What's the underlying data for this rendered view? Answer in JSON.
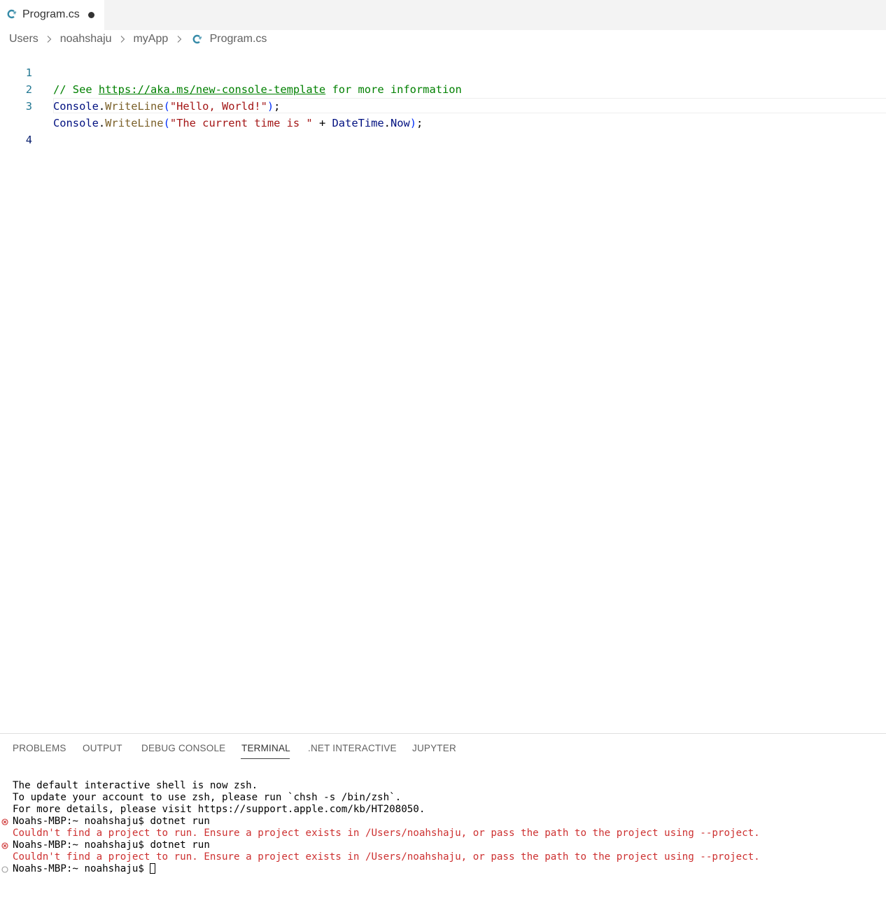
{
  "tab": {
    "label": "Program.cs",
    "dirty_indicator": "●"
  },
  "breadcrumb": {
    "items": [
      "Users",
      "noahshaju",
      "myApp",
      "Program.cs"
    ]
  },
  "editor": {
    "line_numbers": [
      "1",
      "2",
      "3",
      "4"
    ],
    "lines": [
      [
        {
          "text": "// See ",
          "kind": "comment"
        },
        {
          "text": "https://aka.ms/new-console-template",
          "kind": "link"
        },
        {
          "text": " for more information",
          "kind": "comment"
        }
      ],
      [
        {
          "text": "Console",
          "kind": "type"
        },
        {
          "text": ".",
          "kind": "punc"
        },
        {
          "text": "WriteLine",
          "kind": "method"
        },
        {
          "text": "(",
          "kind": "paren"
        },
        {
          "text": "\"Hello, World!\"",
          "kind": "string"
        },
        {
          "text": ")",
          "kind": "paren"
        },
        {
          "text": ";",
          "kind": "punc"
        }
      ],
      [
        {
          "text": "Console",
          "kind": "type"
        },
        {
          "text": ".",
          "kind": "punc"
        },
        {
          "text": "WriteLine",
          "kind": "method"
        },
        {
          "text": "(",
          "kind": "paren"
        },
        {
          "text": "\"The current time is \"",
          "kind": "string"
        },
        {
          "text": " + ",
          "kind": "punc"
        },
        {
          "text": "DateTime",
          "kind": "type"
        },
        {
          "text": ".",
          "kind": "punc"
        },
        {
          "text": "Now",
          "kind": "type"
        },
        {
          "text": ")",
          "kind": "paren"
        },
        {
          "text": ";",
          "kind": "punc"
        }
      ],
      []
    ]
  },
  "panel": {
    "tabs": [
      "PROBLEMS",
      "OUTPUT",
      "DEBUG CONSOLE",
      "TERMINAL",
      ".NET INTERACTIVE",
      "JUPYTER"
    ],
    "active_tab": "TERMINAL"
  },
  "terminal": {
    "lines": [
      {
        "text": "The default interactive shell is now zsh.",
        "kind": "normal",
        "decoration": "none"
      },
      {
        "text": "To update your account to use zsh, please run `chsh -s /bin/zsh`.",
        "kind": "normal",
        "decoration": "none"
      },
      {
        "text": "For more details, please visit https://support.apple.com/kb/HT208050.",
        "kind": "normal",
        "decoration": "none"
      },
      {
        "text": "Noahs-MBP:~ noahshaju$ dotnet run",
        "kind": "normal",
        "decoration": "error"
      },
      {
        "text": "Couldn't find a project to run. Ensure a project exists in /Users/noahshaju, or pass the path to the project using --project.",
        "kind": "error",
        "decoration": "none"
      },
      {
        "text": "Noahs-MBP:~ noahshaju$ dotnet run",
        "kind": "normal",
        "decoration": "error"
      },
      {
        "text": "Couldn't find a project to run. Ensure a project exists in /Users/noahshaju, or pass the path to the project using --project.",
        "kind": "error",
        "decoration": "none"
      },
      {
        "text": "Noahs-MBP:~ noahshaju$ ",
        "kind": "normal",
        "decoration": "pending",
        "cursor": true
      }
    ]
  },
  "colors": {
    "comment": "#008000",
    "type": "#001080",
    "method": "#795e26",
    "string": "#a31515",
    "paren": "#0431fa",
    "line_number": "#237893",
    "terminal_error": "#cd3131",
    "csharp_icon": "#368ba8"
  },
  "icons": {
    "tab": "csharp-file-icon",
    "breadcrumb_sep": "chevron-right-icon",
    "breadcrumb_file": "csharp-file-icon",
    "decoration_error": "error-circle-icon",
    "decoration_pending": "hollow-circle-icon"
  }
}
